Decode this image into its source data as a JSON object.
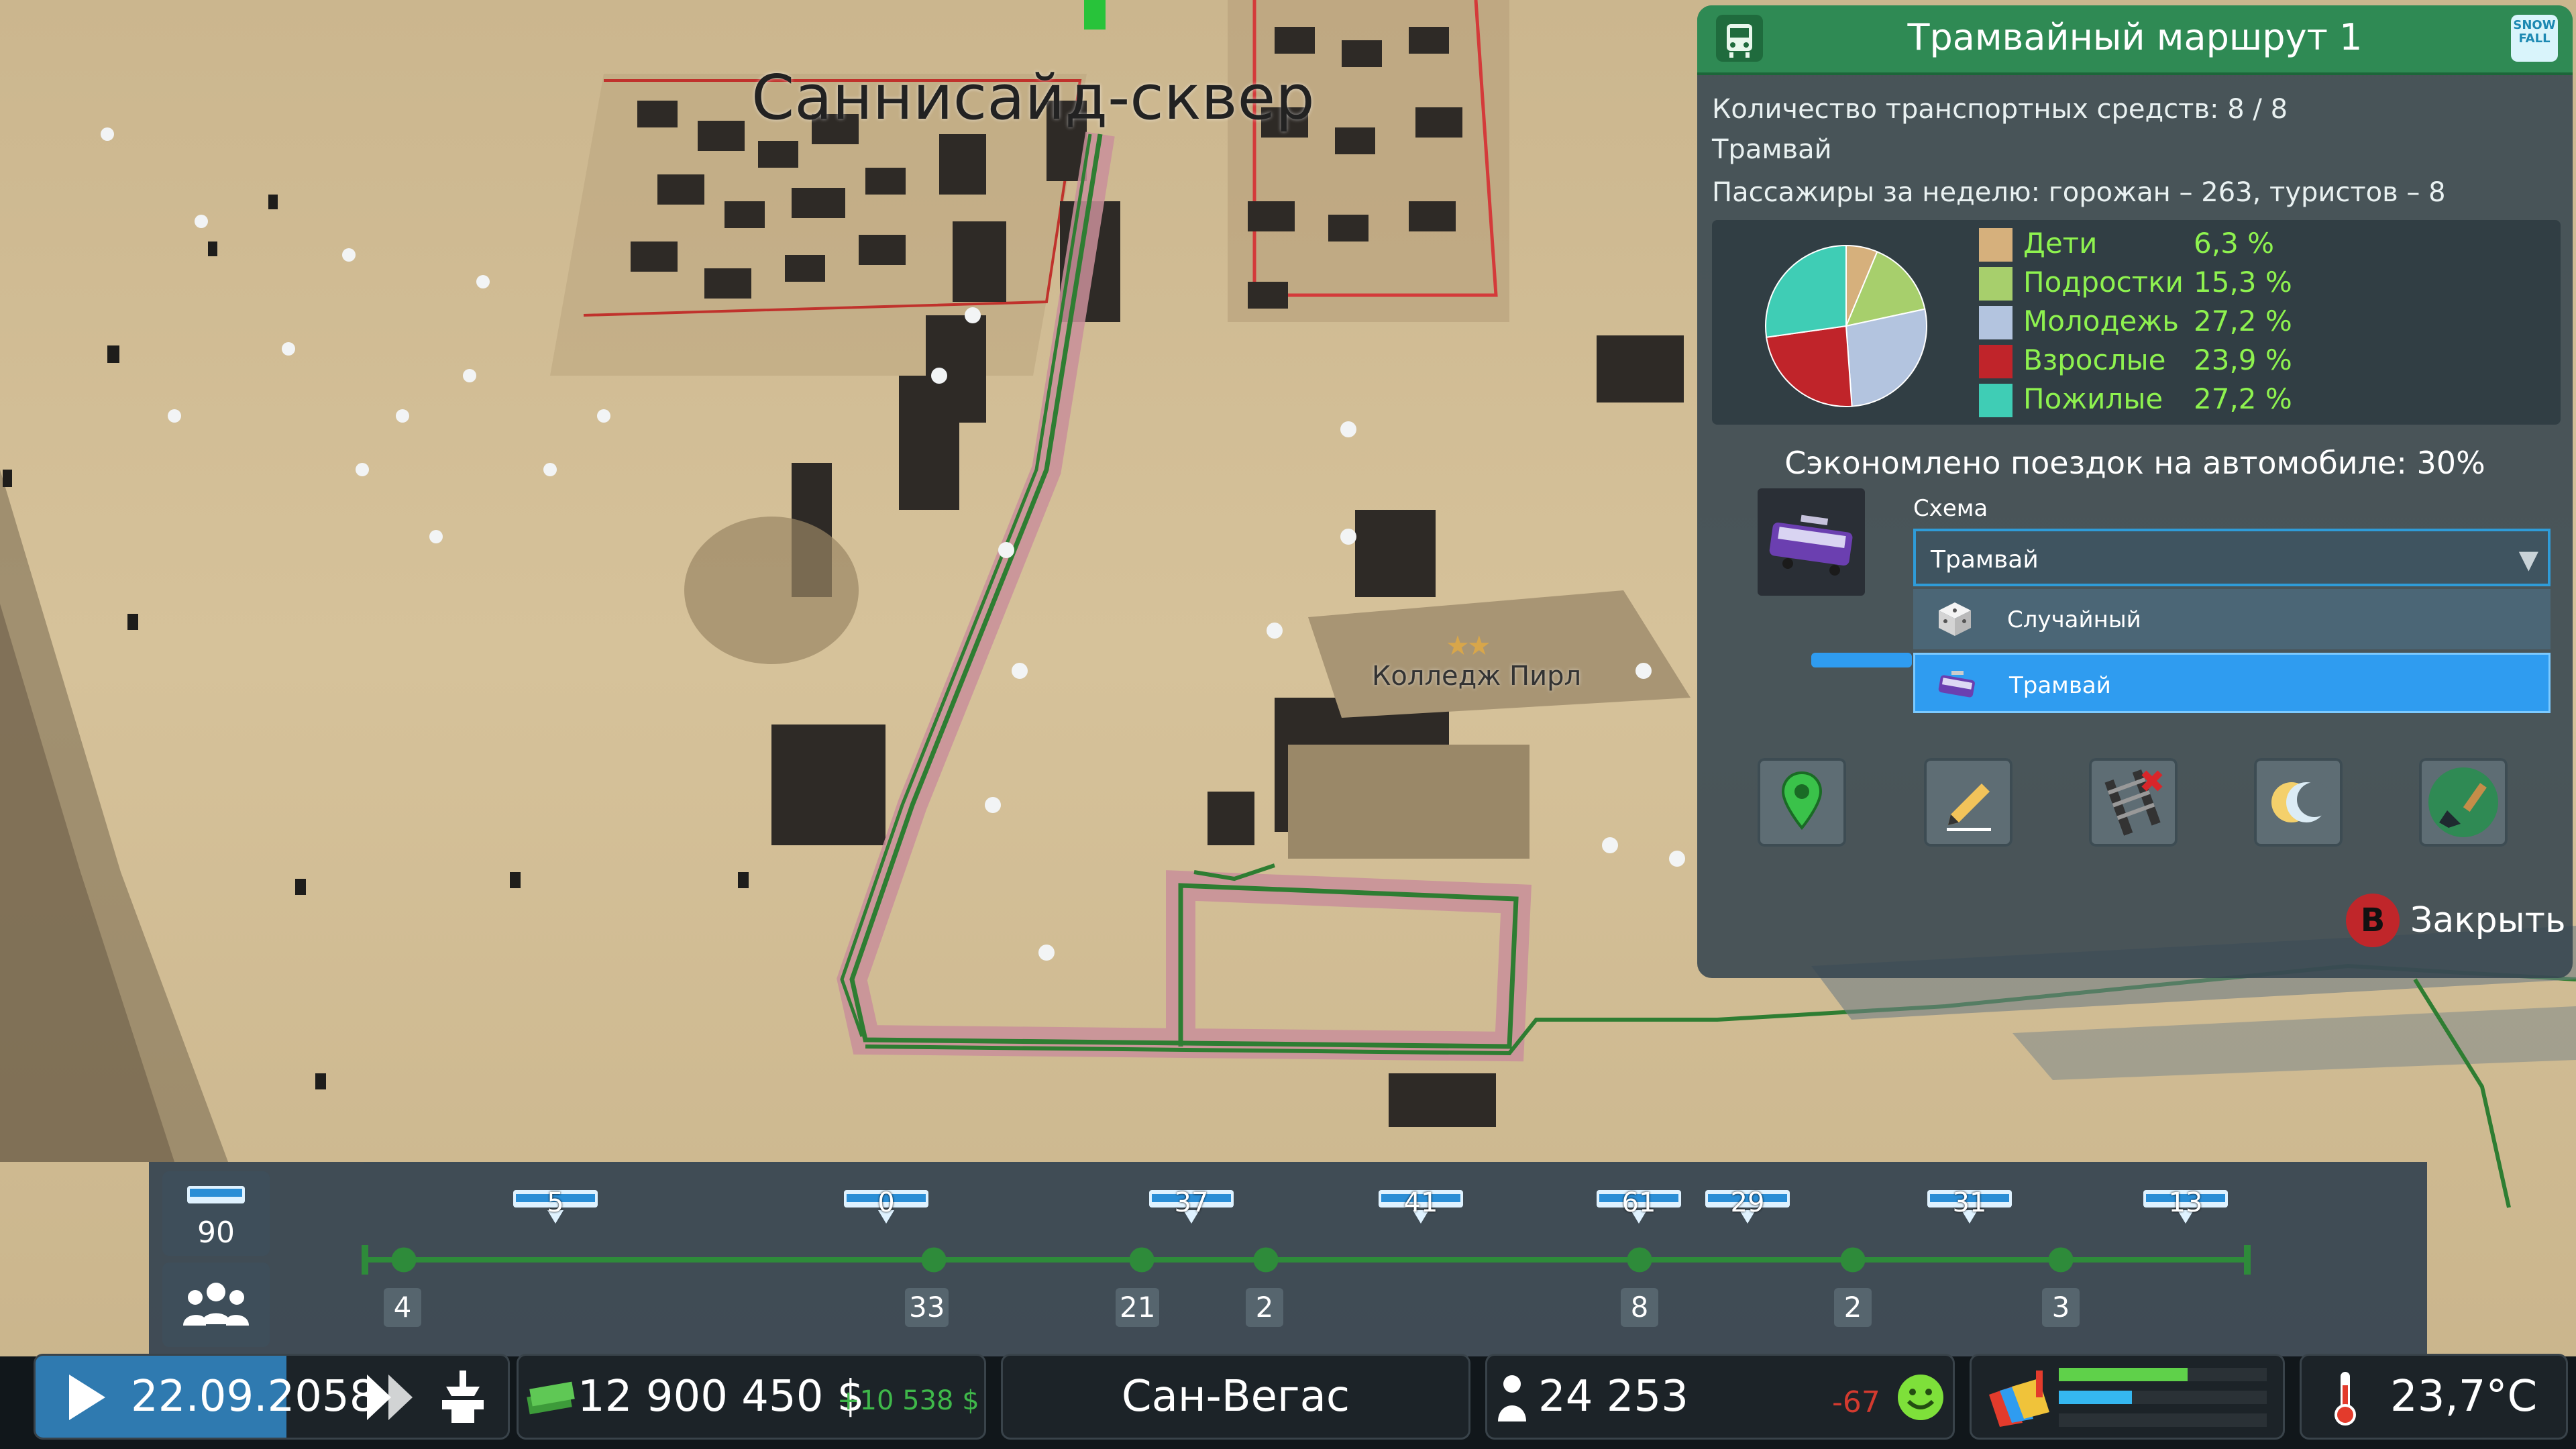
{
  "map": {
    "district_name": "Саннисайд-сквер",
    "building_name": "Колледж Пирл",
    "building_stars": "★★"
  },
  "panel": {
    "title": "Трамвайный маршрут 1",
    "vehicles_line": "Количество транспортных средств: 8 / 8",
    "type_line": "Трамвай",
    "passengers_line": "Пассажиры за неделю: горожан – 263, туристов – 8",
    "age_groups": [
      {
        "name": "Дети",
        "value": "6,3 %",
        "percent": 6.3,
        "color": "#d6b07c"
      },
      {
        "name": "Подростки",
        "value": "15,3 %",
        "percent": 15.3,
        "color": "#a7cf6c"
      },
      {
        "name": "Молодежь",
        "value": "27,2 %",
        "percent": 27.2,
        "color": "#b3c4df"
      },
      {
        "name": "Взрослые",
        "value": "23,9 %",
        "percent": 23.9,
        "color": "#c0242a"
      },
      {
        "name": "Пожилые",
        "value": "27,2 %",
        "percent": 27.2,
        "color": "#3fcdb5"
      }
    ],
    "saved_trips": "Сэкономлено поездок на автомобиле: 30%",
    "schema_label": "Схема",
    "schema_value": "Трамвай",
    "schema_options": [
      "Случайный",
      "Трамвай"
    ],
    "tools": [
      "location-pin-icon",
      "edit-pencil-icon",
      "delete-route-icon",
      "day-night-icon",
      "paint-brush-icon"
    ],
    "close_key": "B",
    "close_label": "Закрыть",
    "header_badge": "SNOW FALL"
  },
  "route_line": {
    "total_vehicles": "90",
    "vehicle_counts": [
      "5",
      "0",
      "37",
      "41",
      "61",
      "29",
      "31",
      "13"
    ],
    "stop_waiting": [
      "4",
      "33",
      "21",
      "2",
      "8",
      "2",
      "3"
    ]
  },
  "bottom_bar": {
    "date": "22.09.2058",
    "money": "12 900 450 $",
    "money_delta": "+10 538 $",
    "city_name": "Сан-Вегас",
    "population": "24 253",
    "population_delta": "-67",
    "temperature": "23,7°C",
    "demand": {
      "residential": 0.62,
      "commercial": 0.35,
      "industrial": 0.0
    }
  },
  "colors": {
    "header_green": "#2f8a54",
    "route_green": "#2e7d32",
    "legend_text": "#8ef24f",
    "selected_blue": "#2f9cf0",
    "money_delta": "#3fb84a",
    "pop_delta": "#d33a2f"
  }
}
